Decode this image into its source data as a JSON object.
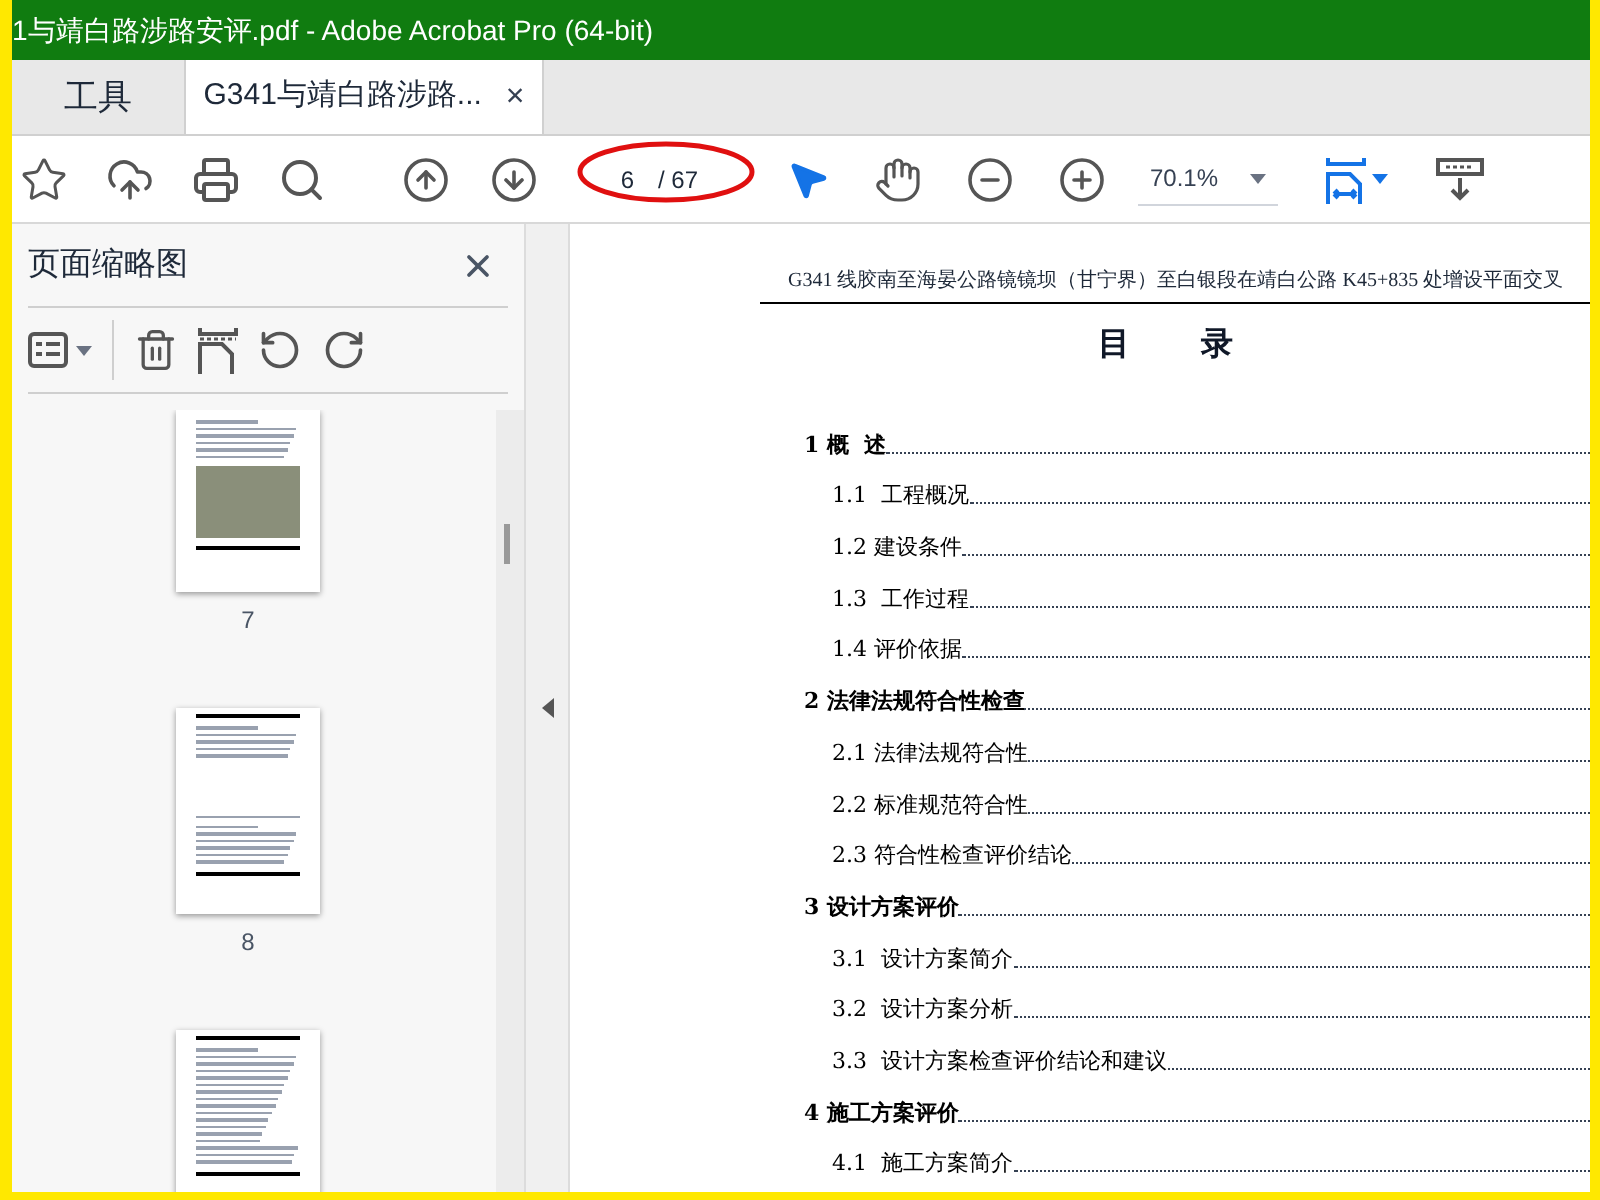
{
  "window": {
    "title": "1与靖白路涉路安评.pdf - Adobe Acrobat Pro (64-bit)"
  },
  "tabs": [
    {
      "label": "工具",
      "selected": false
    },
    {
      "label": "G341与靖白路涉路...",
      "selected": true,
      "close": "×"
    }
  ],
  "toolbar": {
    "page_current": "6",
    "page_total": "/ 67",
    "zoom": "70.1%"
  },
  "sidebar": {
    "title": "页面缩略图",
    "thumbnails": [
      {
        "kind": "photo",
        "label": "7"
      },
      {
        "kind": "diagram",
        "label": "8"
      },
      {
        "kind": "text"
      }
    ]
  },
  "document": {
    "header": "G341 线胶南至海晏公路镜镜坝（甘宁界）至白银段在靖白公路 K45+835 处增设平面交叉",
    "title": "目　录",
    "toc": [
      {
        "text": "1 概  述",
        "children": [
          {
            "text": "1.1  工程概况"
          },
          {
            "text": "1.2 建设条件"
          },
          {
            "text": "1.3  工作过程"
          },
          {
            "text": "1.4 评价依据"
          }
        ]
      },
      {
        "text": "2 法律法规符合性检查",
        "children": [
          {
            "text": "2.1 法律法规符合性"
          },
          {
            "text": "2.2 标准规范符合性"
          },
          {
            "text": "2.3 符合性检查评价结论"
          }
        ]
      },
      {
        "text": "3 设计方案评价",
        "children": [
          {
            "text": "3.1  设计方案简介"
          },
          {
            "text": "3.2  设计方案分析"
          },
          {
            "text": "3.3  设计方案检查评价结论和建议"
          }
        ]
      },
      {
        "text": "4 施工方案评价",
        "children": [
          {
            "text": "4.1  施工方案简介"
          }
        ]
      }
    ]
  }
}
